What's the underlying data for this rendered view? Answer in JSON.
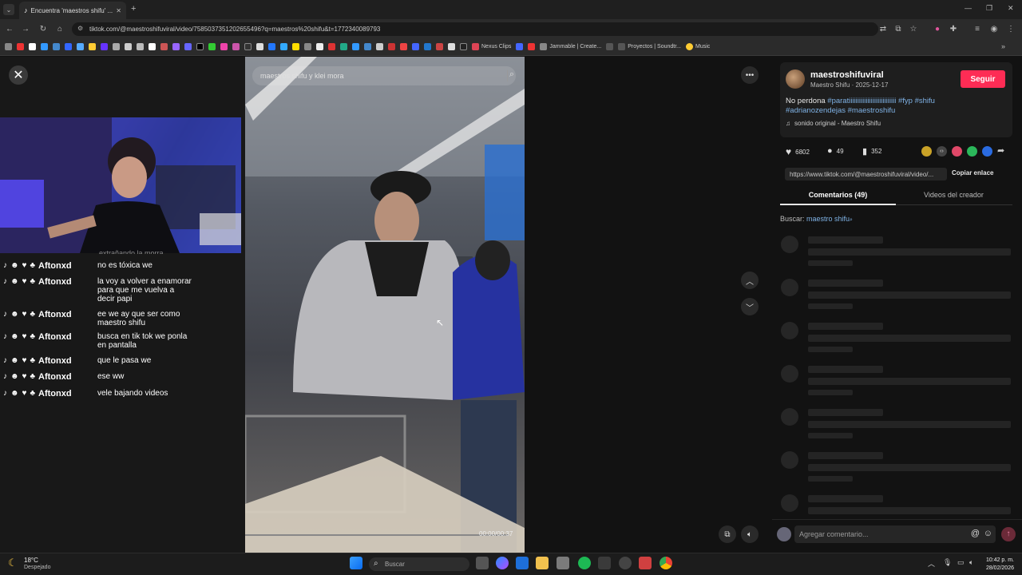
{
  "browser": {
    "tab_title": "Encuentra 'maestros shifu' ...",
    "url": "tiktok.com/@maestroshifuviral/video/7585037351202655496?q=maestros%20shifu&t=1772340089793",
    "bookmarks": [
      {
        "label": "Nexus Clips"
      },
      {
        "label": "Jammable | Create..."
      },
      {
        "label": "Proyectos | Soundtr..."
      },
      {
        "label": "Music"
      }
    ]
  },
  "video": {
    "search_text": "maestros shifu y klei mora",
    "timestamp": "00:00/00:37"
  },
  "chat": {
    "partial_top": "extrañando la morra",
    "messages": [
      {
        "user": "Aftonxd",
        "text": "no es tóxica we"
      },
      {
        "user": "Aftonxd",
        "text": "la voy a volver a enamorar para que me vuelva a decir papi"
      },
      {
        "user": "Aftonxd",
        "text": "ee we ay que ser como maestro shifu"
      },
      {
        "user": "Aftonxd",
        "text": "busca en tik tok we ponla en pantalla"
      },
      {
        "user": "Aftonxd",
        "text": "que le pasa we"
      },
      {
        "user": "Aftonxd",
        "text": "ese ww"
      },
      {
        "user": "Aftonxd",
        "text": "vele bajando videos"
      }
    ]
  },
  "creator": {
    "username": "maestroshifuviral",
    "display_line": "Maestro Shifu · 2025-12-17",
    "follow_label": "Seguir",
    "caption_plain": "No perdona ",
    "caption_tags_1": "#paratiiiiiiiiiiiiiiiiiiiiiiiiiiii #fyp #shifu",
    "caption_tags_2": "#adrianozendejas #maestroshifu",
    "sound": "sonido original - Maestro Shifu"
  },
  "stats": {
    "likes": "6802",
    "comments": "49",
    "saves": "352"
  },
  "link": {
    "url": "https://www.tiktok.com/@maestroshifuviral/video/...",
    "copy_label": "Copiar enlace"
  },
  "tabs": [
    {
      "label": "Comentarios (49)"
    },
    {
      "label": "Videos del creador"
    }
  ],
  "search_related": {
    "prefix": "Buscar: ",
    "term": "maestro shifu"
  },
  "comment_input": {
    "placeholder": "Agregar comentario..."
  },
  "taskbar": {
    "weather_temp": "18°C",
    "weather_desc": "Despejado",
    "search_placeholder": "Buscar",
    "time": "10:42 p. m.",
    "date": "28/02/2026"
  },
  "colors": {
    "accent": "#fe2c55",
    "hashtag": "#7fb2e5"
  }
}
